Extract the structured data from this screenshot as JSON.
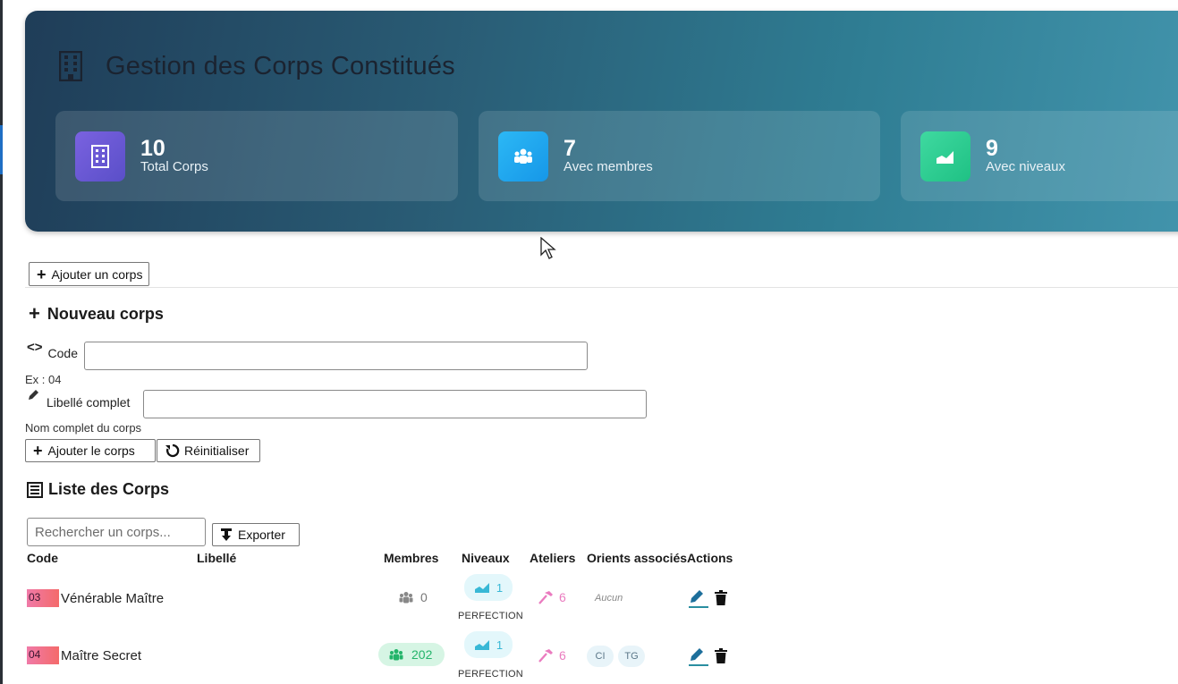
{
  "header": {
    "title": "Gestion des Corps Constitués",
    "icon": "building-icon",
    "stats": [
      {
        "value": "10",
        "label": "Total Corps",
        "icon": "building-icon",
        "color": "#6b5bd6"
      },
      {
        "value": "7",
        "label": "Avec membres",
        "icon": "users-icon",
        "color": "#1ea9f2"
      },
      {
        "value": "9",
        "label": "Avec niveaux",
        "icon": "chart-icon",
        "color": "#22c98a"
      }
    ]
  },
  "toolbar": {
    "add_corps_label": "Ajouter un corps"
  },
  "form": {
    "title": "Nouveau corps",
    "code_label": "Code",
    "code_value": "",
    "code_hint": "Ex : 04",
    "libelle_label": "Libellé complet",
    "libelle_value": "",
    "libelle_hint": "Nom complet du corps",
    "submit_label": "Ajouter le corps",
    "reset_label": "Réinitialiser"
  },
  "list": {
    "title": "Liste des Corps",
    "search_placeholder": "Rechercher un corps...",
    "export_label": "Exporter",
    "columns": [
      "Code",
      "Libellé",
      "Membres",
      "Niveaux",
      "Ateliers",
      "Orients associés",
      "Actions"
    ],
    "rows": [
      {
        "code": "03",
        "libelle": "Vénérable Maître",
        "membres": "0",
        "niveaux": "1",
        "niveau_label": "PERFECTION",
        "ateliers": "6",
        "orients": [],
        "orients_empty": "Aucun"
      },
      {
        "code": "04",
        "libelle": "Maître Secret",
        "membres": "202",
        "niveaux": "1",
        "niveau_label": "PERFECTION",
        "ateliers": "6",
        "orients": [
          "CI",
          "TG"
        ]
      }
    ]
  }
}
